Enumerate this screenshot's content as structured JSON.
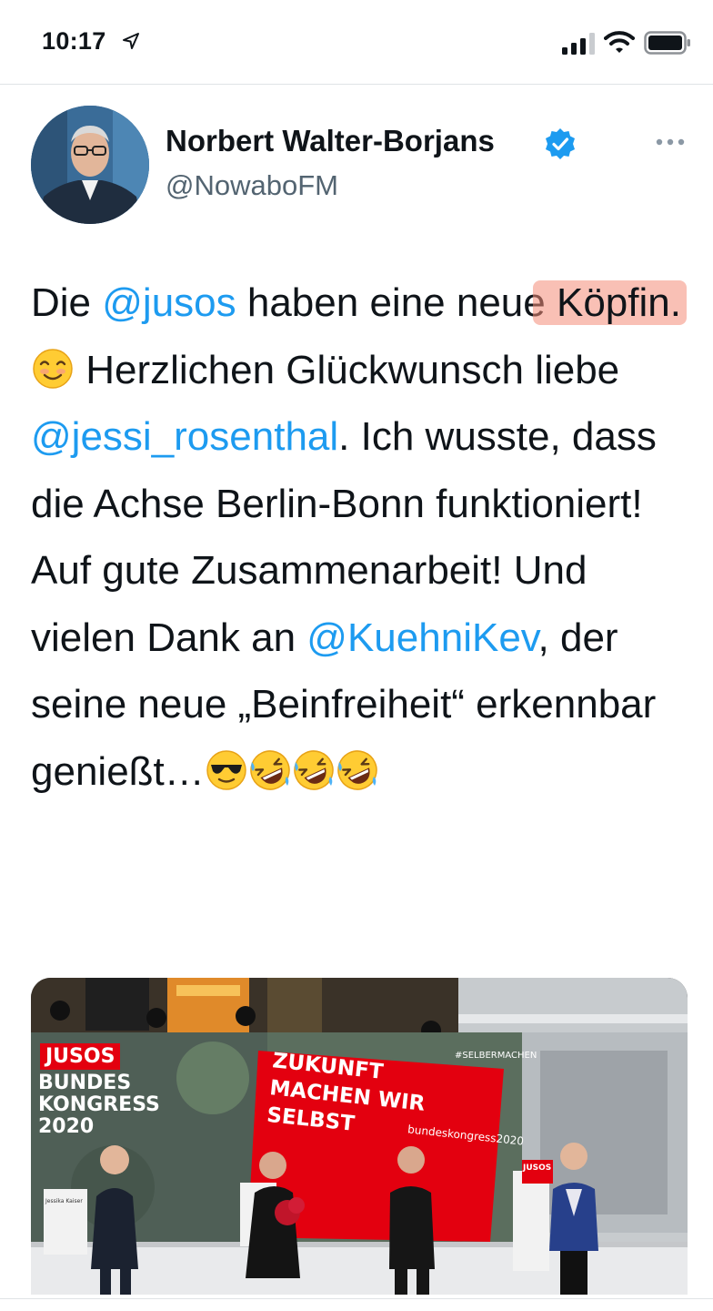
{
  "status_bar": {
    "time": "10:17",
    "icons": [
      "location-arrow-icon",
      "cellular-signal-icon",
      "wifi-icon",
      "battery-icon"
    ]
  },
  "tweet": {
    "author": {
      "name": "Norbert Walter-Borjans",
      "handle": "@NowaboFM",
      "verified": true
    },
    "text": {
      "p1": "Die ",
      "m1": "@jusos",
      "p2": " haben eine neue ",
      "highlight": "Köpfin.",
      "p3": " Herzlichen Glückwunsch liebe ",
      "m2": "@jessi_rosenthal",
      "p4": ". Ich wusste, dass die Achse Berlin-Bonn funktioniert! Auf gute Zusammenarbeit! Und vielen Dank an ",
      "m3": "@KuehniKev",
      "p5": ", der seine neue „Beinfreiheit“ erkennbar genießt…"
    },
    "emojis": [
      "smiling-face-icon",
      "sunglasses-face-icon",
      "rolling-laughing-icon",
      "rolling-laughing-icon",
      "rolling-laughing-icon"
    ],
    "photo": {
      "stage_logo": "JUSOS",
      "congress": "BUNDES KONGRESS 2020",
      "banner": "ZUKUNFT MACHEN WIR SELBST",
      "banner_url": "bundeskongress2020",
      "hashtag": "#SELBERMACHEN",
      "podium": "JUSOS",
      "nameplate": "Jessika Kaiser"
    }
  },
  "colors": {
    "accent": "#1d9bf0",
    "text": "#0f1419",
    "secondary": "#536471",
    "highlight": "#f48c78",
    "spd_red": "#e3000f"
  }
}
